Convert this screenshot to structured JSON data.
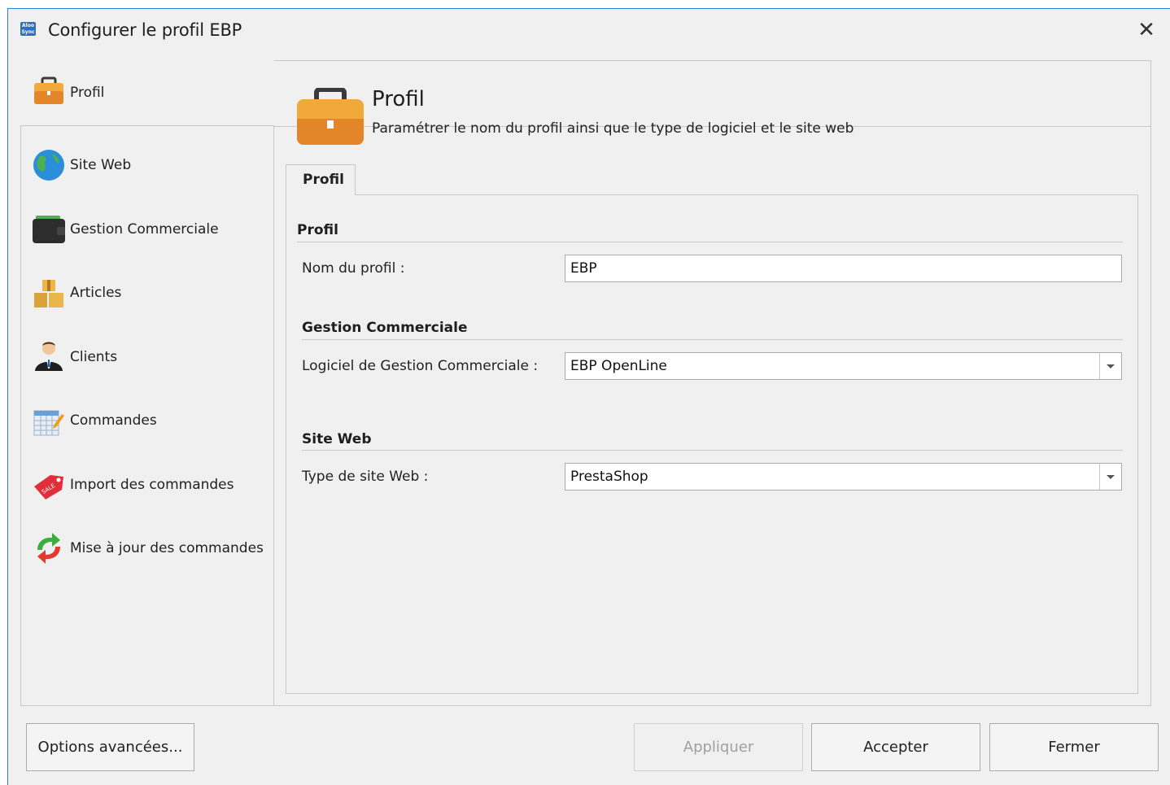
{
  "window": {
    "title": "Configurer le profil EBP",
    "app_icon_text": "Aloo Sync"
  },
  "sidebar": {
    "items": [
      {
        "label": "Profil",
        "icon": "briefcase-icon"
      },
      {
        "label": "Site Web",
        "icon": "globe-icon"
      },
      {
        "label": "Gestion Commerciale",
        "icon": "wallet-icon"
      },
      {
        "label": "Articles",
        "icon": "boxes-icon"
      },
      {
        "label": "Clients",
        "icon": "person-icon"
      },
      {
        "label": "Commandes",
        "icon": "calendar-icon"
      },
      {
        "label": "Import des commandes",
        "icon": "sale-tag-icon"
      },
      {
        "label": "Mise à jour des commandes",
        "icon": "sync-arrows-icon"
      }
    ],
    "selected": "Profil"
  },
  "header": {
    "title": "Profil",
    "subtitle": "Paramétrer le nom du profil ainsi que le type de logiciel et le site web"
  },
  "tabs": [
    {
      "label": "Profil"
    }
  ],
  "form": {
    "profil_group": "Profil",
    "nom_label": "Nom du profil :",
    "nom_value": "EBP",
    "gestion_group": "Gestion Commerciale",
    "logiciel_label": "Logiciel de Gestion Commerciale :",
    "logiciel_value": "EBP OpenLine",
    "site_group": "Site Web",
    "type_label": "Type de site Web :",
    "type_value": "PrestaShop"
  },
  "buttons": {
    "options": "Options avancées...",
    "appliquer": "Appliquer",
    "accepter": "Accepter",
    "fermer": "Fermer"
  },
  "colors": {
    "accent": "#2b7bd6",
    "briefcase": "#f0a020"
  }
}
